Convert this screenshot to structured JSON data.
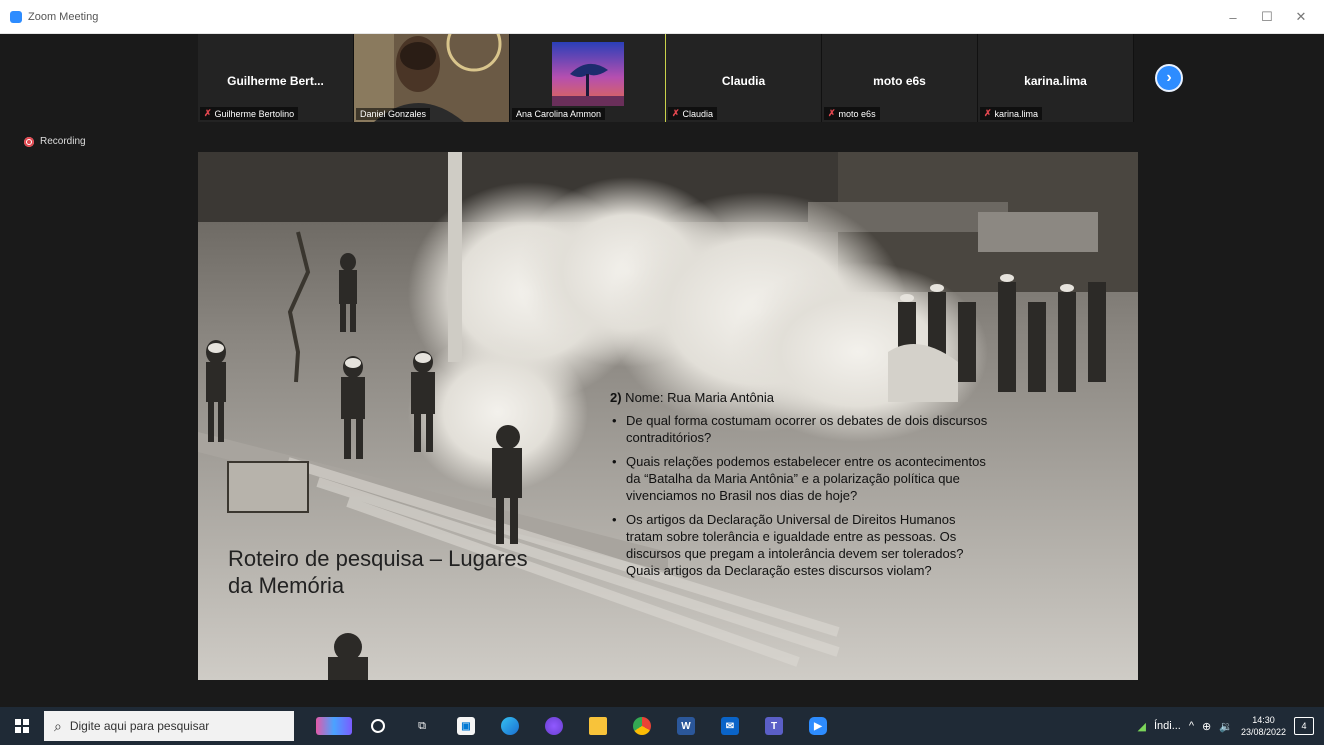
{
  "window": {
    "title": "Zoom Meeting",
    "controls": {
      "minimize": "–",
      "maximize": "☐",
      "close": "✕"
    }
  },
  "meeting": {
    "recording_label": "Recording",
    "participants": [
      {
        "display_name": "Guilherme Bert...",
        "tag": "Guilherme Bertolino",
        "muted": true,
        "video": false
      },
      {
        "display_name": "",
        "tag": "Daniel Gonzales",
        "muted": false,
        "video": true
      },
      {
        "display_name": "",
        "tag": "Ana Carolina Ammon",
        "muted": false,
        "video": true
      },
      {
        "display_name": "Claudia",
        "tag": "Claudia",
        "muted": true,
        "video": false
      },
      {
        "display_name": "moto e6s",
        "tag": "moto e6s",
        "muted": true,
        "video": false
      },
      {
        "display_name": "karina.lima",
        "tag": "karina.lima",
        "muted": true,
        "video": false
      }
    ],
    "next_icon": "chevron-right-icon"
  },
  "slide": {
    "title_line1": "Roteiro de pesquisa – Lugares",
    "title_line2": "da Memória",
    "heading_num": "2)",
    "heading_text": " Nome: Rua Maria Antônia",
    "bullets": [
      "De qual forma costumam ocorrer os debates de dois discursos contraditórios?",
      "Quais relações podemos estabelecer entre os acontecimentos da “Batalha da Maria Antônia” e a polarização política que vivenciamos no Brasil nos dias de hoje?",
      "Os artigos da Declaração Universal de Direitos Humanos tratam sobre tolerância e igualdade entre as pessoas. Os discursos que pregam a intolerância devem ser tolerados? Quais artigos da Declaração estes discursos violam?"
    ]
  },
  "taskbar": {
    "search_placeholder": "Digite aqui para pesquisar",
    "weather": "Índi...",
    "time": "14:30",
    "date": "23/08/2022",
    "notifications": "4"
  }
}
